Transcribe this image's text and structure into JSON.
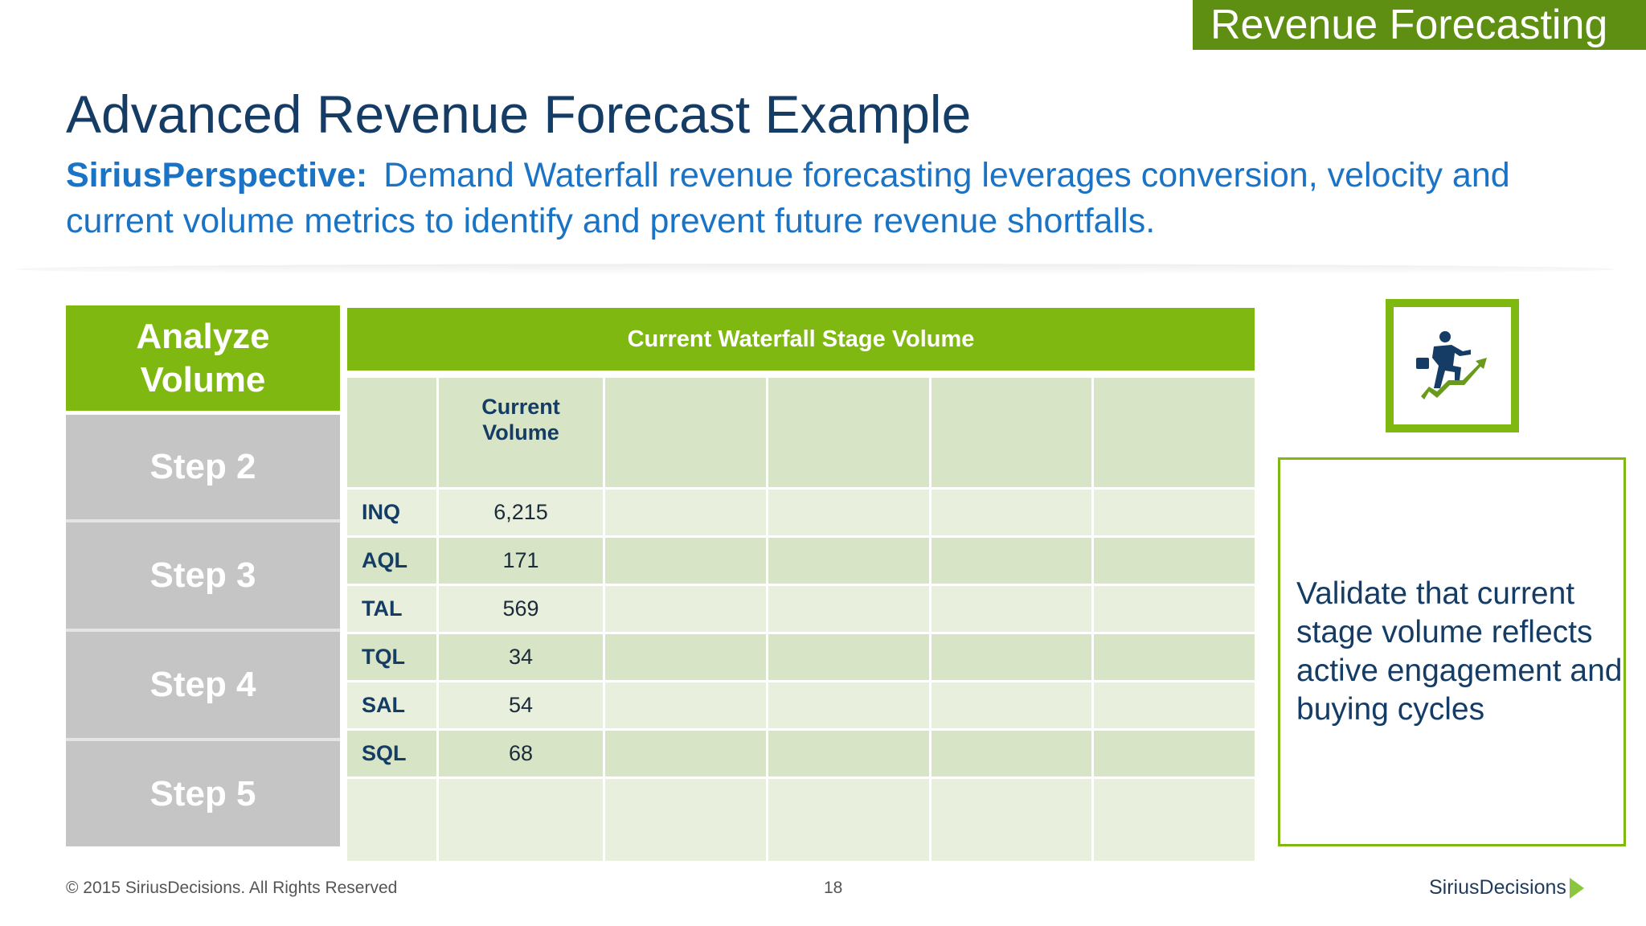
{
  "banner": "Revenue Forecasting",
  "title": "Advanced Revenue Forecast Example",
  "subtitle": {
    "label": "SiriusPerspective:",
    "text": "Demand Waterfall revenue forecasting leverages conversion, velocity and current volume metrics to identify and prevent future revenue shortfalls."
  },
  "steps": {
    "active": "Analyze Volume",
    "s2": "Step 2",
    "s3": "Step 3",
    "s4": "Step 4",
    "s5": "Step 5"
  },
  "table": {
    "title": "Current Waterfall Stage Volume",
    "col_header": "Current Volume",
    "rows": [
      {
        "stage": "INQ",
        "volume": "6,215"
      },
      {
        "stage": "AQL",
        "volume": "171"
      },
      {
        "stage": "TAL",
        "volume": "569"
      },
      {
        "stage": "TQL",
        "volume": "34"
      },
      {
        "stage": "SAL",
        "volume": "54"
      },
      {
        "stage": "SQL",
        "volume": "68"
      }
    ]
  },
  "icon": "businessman-climbing-growth-arrow-icon",
  "note": "Validate that current stage volume reflects active engagement and buying cycles",
  "footer": {
    "copyright": "© 2015 SiriusDecisions. All Rights Reserved",
    "page": "18",
    "logo": "SiriusDecisions"
  },
  "colors": {
    "green": "#80b812",
    "navy": "#143c64",
    "blue": "#1a73c5"
  }
}
